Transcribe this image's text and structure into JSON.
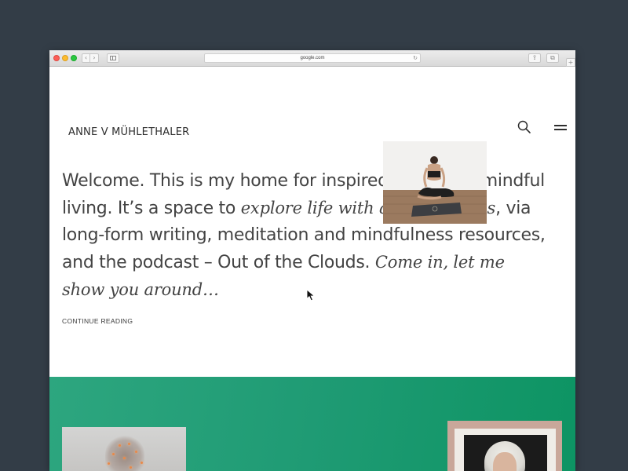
{
  "browser": {
    "address": "google.com",
    "back_glyph": "‹",
    "forward_glyph": "›",
    "reload_glyph": "↻",
    "share_glyph": "⇪",
    "tabs_glyph": "⧉",
    "newtab_glyph": "+"
  },
  "site": {
    "logo": "ANNE V MÜHLETHALER",
    "hero": {
      "part1": "Welcome. This is my home for inspired living and mindful living. It’s a space to ",
      "italic1": "explore life with a mindful lens",
      "part2": ", via long-form writing, meditation and mindfulness resources, and the podcast – Out of the Clouds. ",
      "italic2": "Come in, let me show you around…"
    },
    "continue_label": "CONTINUE READING"
  },
  "colors": {
    "page_background": "#333d47",
    "text": "#434343",
    "green_start": "#2da67f",
    "green_end": "#0d9463"
  },
  "icons": [
    "search-icon",
    "menu-icon",
    "cursor-icon",
    "close-icon",
    "minimize-icon",
    "maximize-icon",
    "sidebar-icon",
    "share-icon",
    "tabs-icon",
    "reload-icon"
  ]
}
